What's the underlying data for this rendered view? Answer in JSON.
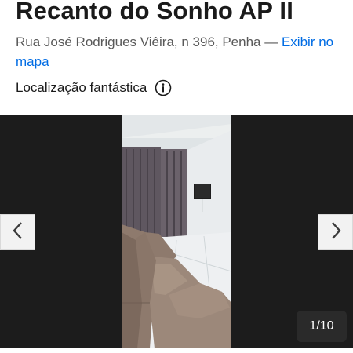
{
  "property": {
    "name": "Recanto do Sonho AP II",
    "address": "Rua José Rodrigues Viêira, n 396, Penha —",
    "map_link": "Exibir no mapa",
    "location_label": "Localização fantástica"
  },
  "gallery": {
    "counter": "1/10",
    "prev_icon": "chevron-left-icon",
    "next_icon": "chevron-right-icon",
    "info_icon": "info-icon"
  }
}
